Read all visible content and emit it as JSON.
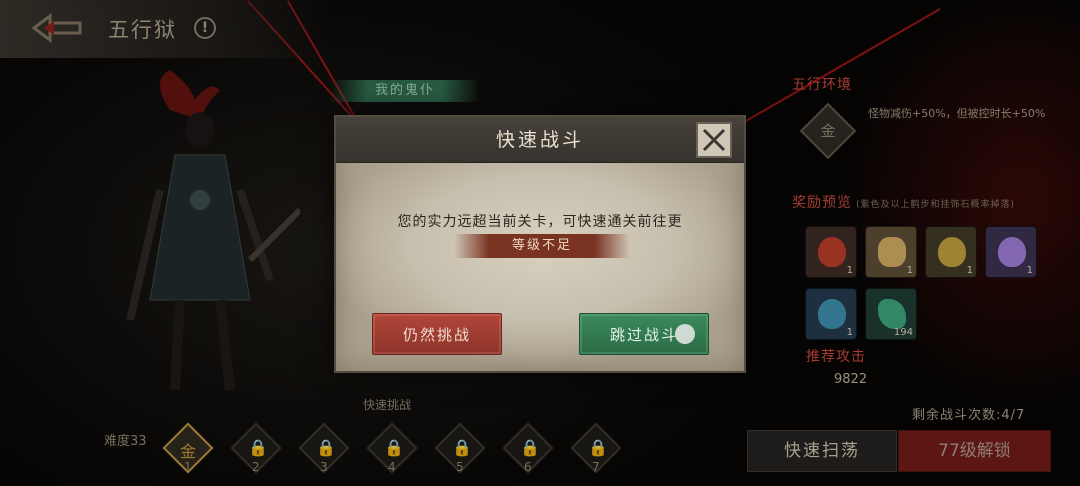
{
  "header": {
    "title": "五行狱",
    "info_label": "!"
  },
  "npc_banner": {
    "label": "我的鬼仆"
  },
  "right_panel": {
    "env_title": "五行环境",
    "env_icon_char": "金",
    "env_text": "怪物减伤+50%，但被控时长+50%",
    "reward_title": "奖励预览",
    "reward_note": "(紫色及以上鹤步和挂饰石概率掉落)",
    "rewards": [
      {
        "count": "1",
        "color": "#b33c28",
        "bg": "#3b2a24"
      },
      {
        "count": "1",
        "color": "#c9a75e",
        "bg": "#5a4a33"
      },
      {
        "count": "1",
        "color": "#b99b3d",
        "bg": "#3f3826"
      },
      {
        "count": "1",
        "color": "#9a7ad1",
        "bg": "#3a2f4d"
      },
      {
        "count": "1",
        "color": "#3d8aa8",
        "bg": "#24394a"
      },
      {
        "count": "194",
        "color": "#3aa07a",
        "bg": "#1f3a33"
      }
    ],
    "power_title": "推荐攻击",
    "power_value": "9822",
    "remaining": "剩余战斗次数:4/7",
    "sweep_label": "快速扫荡",
    "unlock_label": "77级解锁"
  },
  "levels": {
    "difficulty": "难度33",
    "quick_label": "快速挑战",
    "items": [
      {
        "num": "1",
        "glyph": "金",
        "active": true
      },
      {
        "num": "2",
        "glyph": "🔒",
        "active": false
      },
      {
        "num": "3",
        "glyph": "🔒",
        "active": false
      },
      {
        "num": "4",
        "glyph": "🔒",
        "active": false
      },
      {
        "num": "5",
        "glyph": "🔒",
        "active": false
      },
      {
        "num": "6",
        "glyph": "🔒",
        "active": false
      },
      {
        "num": "7",
        "glyph": "🔒",
        "active": false
      }
    ]
  },
  "dialog": {
    "title": "快速战斗",
    "message": "您的实力远超当前关卡，可快速通关前往更",
    "warning": "等级不足",
    "challenge_label": "仍然挑战",
    "skip_label": "跳过战斗"
  },
  "colors": {
    "accent_red": "#c4483b",
    "button_green": "#2a6b45",
    "button_red": "#8e3328"
  }
}
